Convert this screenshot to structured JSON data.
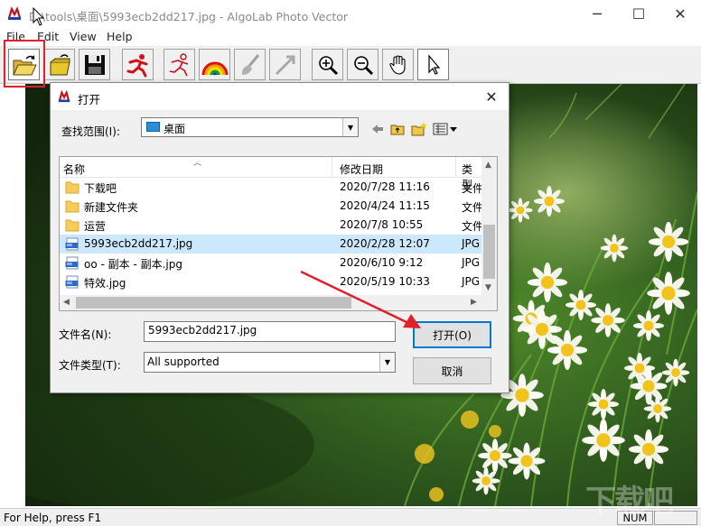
{
  "window": {
    "title": "D:\\tools\\桌面\\5993ecb2dd217.jpg - AlgoLab Photo Vector",
    "controls": [
      "─",
      "☐",
      "✕"
    ]
  },
  "menu": {
    "items": [
      "File",
      "Edit",
      "View",
      "Help"
    ]
  },
  "toolbar": {
    "buttons": [
      {
        "name": "open-icon"
      },
      {
        "name": "open-folder-arrow-icon"
      },
      {
        "name": "save-icon"
      },
      {
        "name": "runner-icon"
      },
      {
        "name": "runner-outline-icon"
      },
      {
        "name": "rainbow-icon"
      },
      {
        "name": "brush-icon"
      },
      {
        "name": "line-tool-icon"
      },
      {
        "name": "zoom-in-icon"
      },
      {
        "name": "zoom-out-icon"
      },
      {
        "name": "hand-icon"
      },
      {
        "name": "pointer-icon"
      }
    ]
  },
  "dialog": {
    "title": "打开",
    "close": "✕",
    "look_in_label": "查找范围(I):",
    "look_in_value": "桌面",
    "columns": {
      "name": "名称",
      "modified": "修改日期",
      "type": "类型"
    },
    "files": [
      {
        "name": "下载吧",
        "date": "2020/7/28 11:16",
        "type": "文件",
        "icon": "folder-icon"
      },
      {
        "name": "新建文件夹",
        "date": "2020/4/24 11:15",
        "type": "文件",
        "icon": "folder-icon"
      },
      {
        "name": "运营",
        "date": "2020/7/8 10:55",
        "type": "文件",
        "icon": "folder-icon"
      },
      {
        "name": "5993ecb2dd217.jpg",
        "date": "2020/2/28 12:07",
        "type": "JPG",
        "icon": "jpg-file-icon",
        "selected": true
      },
      {
        "name": "oo - 副本 - 副本.jpg",
        "date": "2020/6/10 9:12",
        "type": "JPG",
        "icon": "jpg-file-icon"
      },
      {
        "name": "特效.jpg",
        "date": "2020/5/19 10:33",
        "type": "JPG",
        "icon": "jpg-file-icon"
      }
    ],
    "filename_label": "文件名(N):",
    "filename_value": "5993ecb2dd217.jpg",
    "filetype_label": "文件类型(T):",
    "filetype_value": "All supported",
    "open_button": "打开(O)",
    "cancel_button": "取消"
  },
  "status": {
    "help_text": "For Help, press F1",
    "num": "NUM"
  },
  "watermark": "下载吧"
}
